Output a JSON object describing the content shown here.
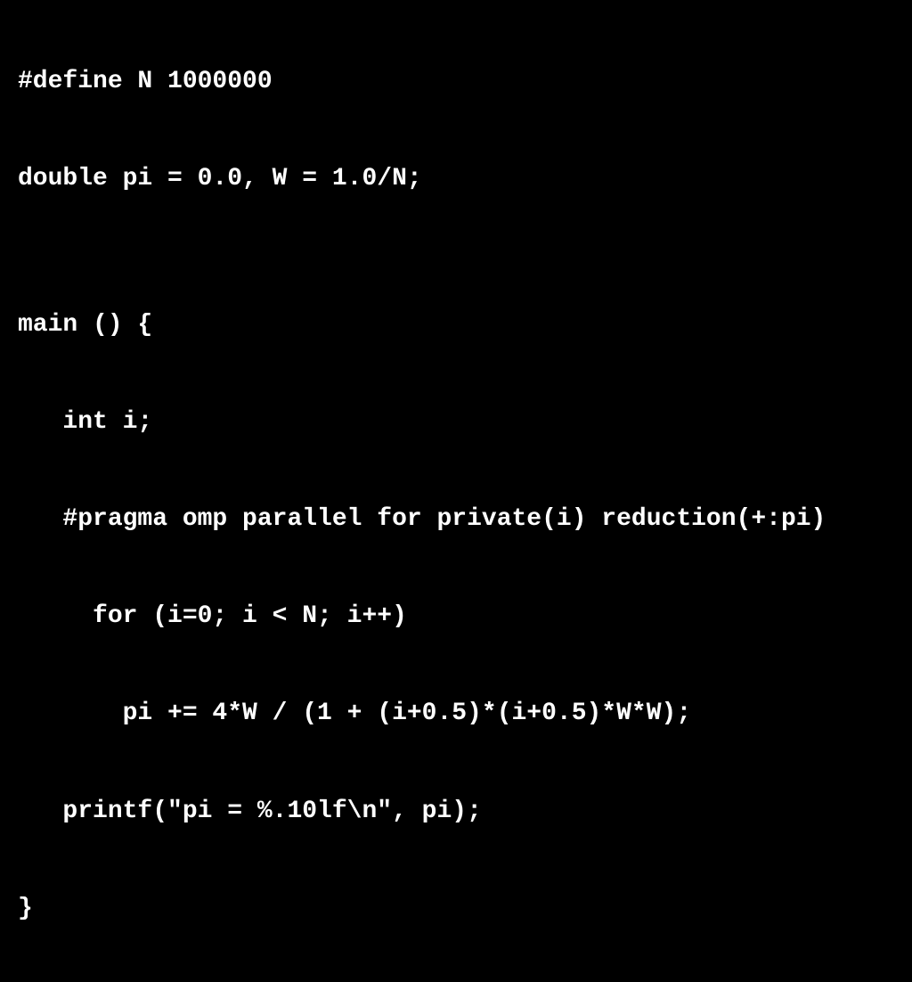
{
  "code": {
    "lines": [
      "#define N 1000000",
      "double pi = 0.0, W = 1.0/N;",
      "",
      "main () {",
      "   int i;",
      "   #pragma omp parallel for private(i) reduction(+:pi)",
      "     for (i=0; i < N; i++)",
      "       pi += 4*W / (1 + (i+0.5)*(i+0.5)*W*W);",
      "   printf(\"pi = %.10lf\\n\", pi);",
      "}"
    ]
  }
}
